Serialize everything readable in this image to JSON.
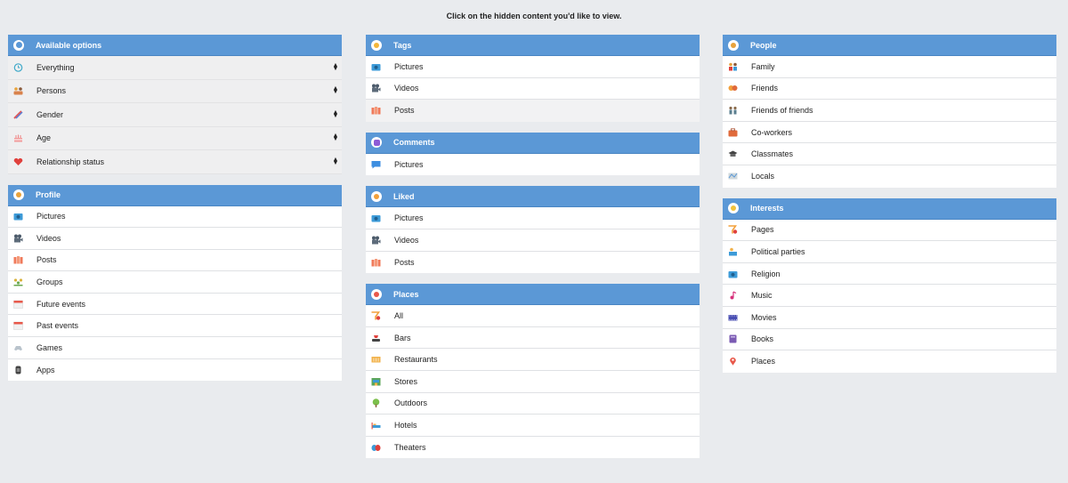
{
  "instruction": "Click on the hidden content you'd like to view.",
  "available_options": {
    "title": "Available options",
    "items": [
      {
        "label": "Everything",
        "icon": "clock-icon"
      },
      {
        "label": "Persons",
        "icon": "persons-icon"
      },
      {
        "label": "Gender",
        "icon": "gender-icon"
      },
      {
        "label": "Age",
        "icon": "cake-icon"
      },
      {
        "label": "Relationship status",
        "icon": "heart-icon"
      }
    ]
  },
  "profile": {
    "title": "Profile",
    "items": [
      "Pictures",
      "Videos",
      "Posts",
      "Groups",
      "Future events",
      "Past events",
      "Games",
      "Apps"
    ]
  },
  "tags": {
    "title": "Tags",
    "items": [
      "Pictures",
      "Videos",
      "Posts"
    ]
  },
  "comments": {
    "title": "Comments",
    "items": [
      "Pictures"
    ]
  },
  "liked": {
    "title": "Liked",
    "items": [
      "Pictures",
      "Videos",
      "Posts"
    ]
  },
  "places": {
    "title": "Places",
    "items": [
      "All",
      "Bars",
      "Restaurants",
      "Stores",
      "Outdoors",
      "Hotels",
      "Theaters"
    ]
  },
  "people": {
    "title": "People",
    "items": [
      "Family",
      "Friends",
      "Friends of friends",
      "Co-workers",
      "Classmates",
      "Locals"
    ]
  },
  "interests": {
    "title": "Interests",
    "items": [
      "Pages",
      "Political parties",
      "Religion",
      "Music",
      "Movies",
      "Books",
      "Places"
    ]
  },
  "colors": {
    "header_bg": "#5b98d6",
    "page_bg": "#e9ebee"
  }
}
